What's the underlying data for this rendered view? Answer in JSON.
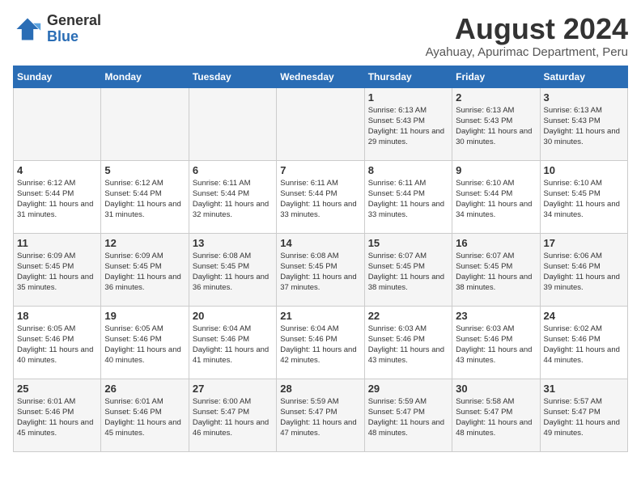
{
  "logo": {
    "general": "General",
    "blue": "Blue"
  },
  "header": {
    "title": "August 2024",
    "subtitle": "Ayahuay, Apurimac Department, Peru"
  },
  "days_of_week": [
    "Sunday",
    "Monday",
    "Tuesday",
    "Wednesday",
    "Thursday",
    "Friday",
    "Saturday"
  ],
  "weeks": [
    [
      {
        "day": "",
        "info": ""
      },
      {
        "day": "",
        "info": ""
      },
      {
        "day": "",
        "info": ""
      },
      {
        "day": "",
        "info": ""
      },
      {
        "day": "1",
        "info": "Sunrise: 6:13 AM\nSunset: 5:43 PM\nDaylight: 11 hours and 29 minutes."
      },
      {
        "day": "2",
        "info": "Sunrise: 6:13 AM\nSunset: 5:43 PM\nDaylight: 11 hours and 30 minutes."
      },
      {
        "day": "3",
        "info": "Sunrise: 6:13 AM\nSunset: 5:43 PM\nDaylight: 11 hours and 30 minutes."
      }
    ],
    [
      {
        "day": "4",
        "info": "Sunrise: 6:12 AM\nSunset: 5:44 PM\nDaylight: 11 hours and 31 minutes."
      },
      {
        "day": "5",
        "info": "Sunrise: 6:12 AM\nSunset: 5:44 PM\nDaylight: 11 hours and 31 minutes."
      },
      {
        "day": "6",
        "info": "Sunrise: 6:11 AM\nSunset: 5:44 PM\nDaylight: 11 hours and 32 minutes."
      },
      {
        "day": "7",
        "info": "Sunrise: 6:11 AM\nSunset: 5:44 PM\nDaylight: 11 hours and 33 minutes."
      },
      {
        "day": "8",
        "info": "Sunrise: 6:11 AM\nSunset: 5:44 PM\nDaylight: 11 hours and 33 minutes."
      },
      {
        "day": "9",
        "info": "Sunrise: 6:10 AM\nSunset: 5:44 PM\nDaylight: 11 hours and 34 minutes."
      },
      {
        "day": "10",
        "info": "Sunrise: 6:10 AM\nSunset: 5:45 PM\nDaylight: 11 hours and 34 minutes."
      }
    ],
    [
      {
        "day": "11",
        "info": "Sunrise: 6:09 AM\nSunset: 5:45 PM\nDaylight: 11 hours and 35 minutes."
      },
      {
        "day": "12",
        "info": "Sunrise: 6:09 AM\nSunset: 5:45 PM\nDaylight: 11 hours and 36 minutes."
      },
      {
        "day": "13",
        "info": "Sunrise: 6:08 AM\nSunset: 5:45 PM\nDaylight: 11 hours and 36 minutes."
      },
      {
        "day": "14",
        "info": "Sunrise: 6:08 AM\nSunset: 5:45 PM\nDaylight: 11 hours and 37 minutes."
      },
      {
        "day": "15",
        "info": "Sunrise: 6:07 AM\nSunset: 5:45 PM\nDaylight: 11 hours and 38 minutes."
      },
      {
        "day": "16",
        "info": "Sunrise: 6:07 AM\nSunset: 5:45 PM\nDaylight: 11 hours and 38 minutes."
      },
      {
        "day": "17",
        "info": "Sunrise: 6:06 AM\nSunset: 5:46 PM\nDaylight: 11 hours and 39 minutes."
      }
    ],
    [
      {
        "day": "18",
        "info": "Sunrise: 6:05 AM\nSunset: 5:46 PM\nDaylight: 11 hours and 40 minutes."
      },
      {
        "day": "19",
        "info": "Sunrise: 6:05 AM\nSunset: 5:46 PM\nDaylight: 11 hours and 40 minutes."
      },
      {
        "day": "20",
        "info": "Sunrise: 6:04 AM\nSunset: 5:46 PM\nDaylight: 11 hours and 41 minutes."
      },
      {
        "day": "21",
        "info": "Sunrise: 6:04 AM\nSunset: 5:46 PM\nDaylight: 11 hours and 42 minutes."
      },
      {
        "day": "22",
        "info": "Sunrise: 6:03 AM\nSunset: 5:46 PM\nDaylight: 11 hours and 43 minutes."
      },
      {
        "day": "23",
        "info": "Sunrise: 6:03 AM\nSunset: 5:46 PM\nDaylight: 11 hours and 43 minutes."
      },
      {
        "day": "24",
        "info": "Sunrise: 6:02 AM\nSunset: 5:46 PM\nDaylight: 11 hours and 44 minutes."
      }
    ],
    [
      {
        "day": "25",
        "info": "Sunrise: 6:01 AM\nSunset: 5:46 PM\nDaylight: 11 hours and 45 minutes."
      },
      {
        "day": "26",
        "info": "Sunrise: 6:01 AM\nSunset: 5:46 PM\nDaylight: 11 hours and 45 minutes."
      },
      {
        "day": "27",
        "info": "Sunrise: 6:00 AM\nSunset: 5:47 PM\nDaylight: 11 hours and 46 minutes."
      },
      {
        "day": "28",
        "info": "Sunrise: 5:59 AM\nSunset: 5:47 PM\nDaylight: 11 hours and 47 minutes."
      },
      {
        "day": "29",
        "info": "Sunrise: 5:59 AM\nSunset: 5:47 PM\nDaylight: 11 hours and 48 minutes."
      },
      {
        "day": "30",
        "info": "Sunrise: 5:58 AM\nSunset: 5:47 PM\nDaylight: 11 hours and 48 minutes."
      },
      {
        "day": "31",
        "info": "Sunrise: 5:57 AM\nSunset: 5:47 PM\nDaylight: 11 hours and 49 minutes."
      }
    ]
  ]
}
